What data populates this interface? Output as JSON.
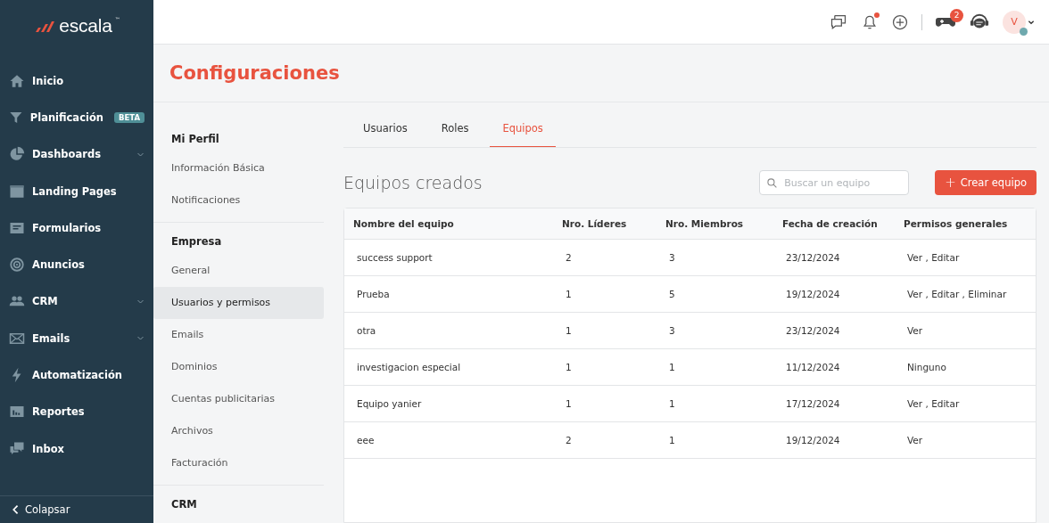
{
  "sidebar": {
    "logo": {
      "text": "escala",
      "trademark": "™"
    },
    "items": [
      {
        "label": "Inicio",
        "expandable": false
      },
      {
        "label": "Planificación",
        "expandable": false,
        "badge": "BETA"
      },
      {
        "label": "Dashboards",
        "expandable": true
      },
      {
        "label": "Landing Pages",
        "expandable": false
      },
      {
        "label": "Formularios",
        "expandable": false
      },
      {
        "label": "Anuncios",
        "expandable": false
      },
      {
        "label": "CRM",
        "expandable": true
      },
      {
        "label": "Emails",
        "expandable": true
      },
      {
        "label": "Automatización",
        "expandable": false
      },
      {
        "label": "Reportes",
        "expandable": false
      },
      {
        "label": "Inbox",
        "expandable": false
      }
    ],
    "collapse": {
      "label": "Colapsar"
    }
  },
  "topbar": {
    "bell_dot": true,
    "games_badge": "2",
    "avatar": {
      "initial": "V",
      "online": true
    }
  },
  "page_title": "Configuraciones",
  "settings_menu": [
    {
      "title": "Mi Perfil",
      "items": [
        {
          "label": "Información Básica",
          "selected": false
        },
        {
          "label": "Notificaciones",
          "selected": false
        }
      ]
    },
    {
      "title": "Empresa",
      "items": [
        {
          "label": "General",
          "selected": false
        },
        {
          "label": "Usuarios y permisos",
          "selected": true
        },
        {
          "label": "Emails",
          "selected": false
        },
        {
          "label": "Dominios",
          "selected": false
        },
        {
          "label": "Cuentas publicitarias",
          "selected": false
        },
        {
          "label": "Archivos",
          "selected": false
        },
        {
          "label": "Facturación",
          "selected": false
        }
      ]
    },
    {
      "title": "CRM"
    }
  ],
  "tabs": [
    {
      "label": "Usuarios",
      "selected": false
    },
    {
      "label": "Roles",
      "selected": false
    },
    {
      "label": "Equipos",
      "selected": true
    }
  ],
  "section_title": "Equipos creados",
  "search": {
    "placeholder": "Buscar un equipo"
  },
  "create_button": {
    "icon": "+",
    "label": "Crear equipo"
  },
  "table": {
    "columns": [
      "Nombre del equipo",
      "Nro. Líderes",
      "Nro. Miembros",
      "Fecha de creación",
      "Permisos generales"
    ],
    "rows": [
      [
        "success support",
        "2",
        "3",
        "23/12/2024",
        "Ver , Editar"
      ],
      [
        "Prueba",
        "1",
        "5",
        "19/12/2024",
        "Ver , Editar , Eliminar"
      ],
      [
        "otra",
        "1",
        "3",
        "23/12/2024",
        "Ver"
      ],
      [
        "investigacion especial",
        "1",
        "1",
        "11/12/2024",
        "Ninguno"
      ],
      [
        "Equipo yanier",
        "1",
        "1",
        "17/12/2024",
        "Ver , Editar"
      ],
      [
        "eee",
        "2",
        "1",
        "19/12/2024",
        "Ver"
      ]
    ]
  }
}
